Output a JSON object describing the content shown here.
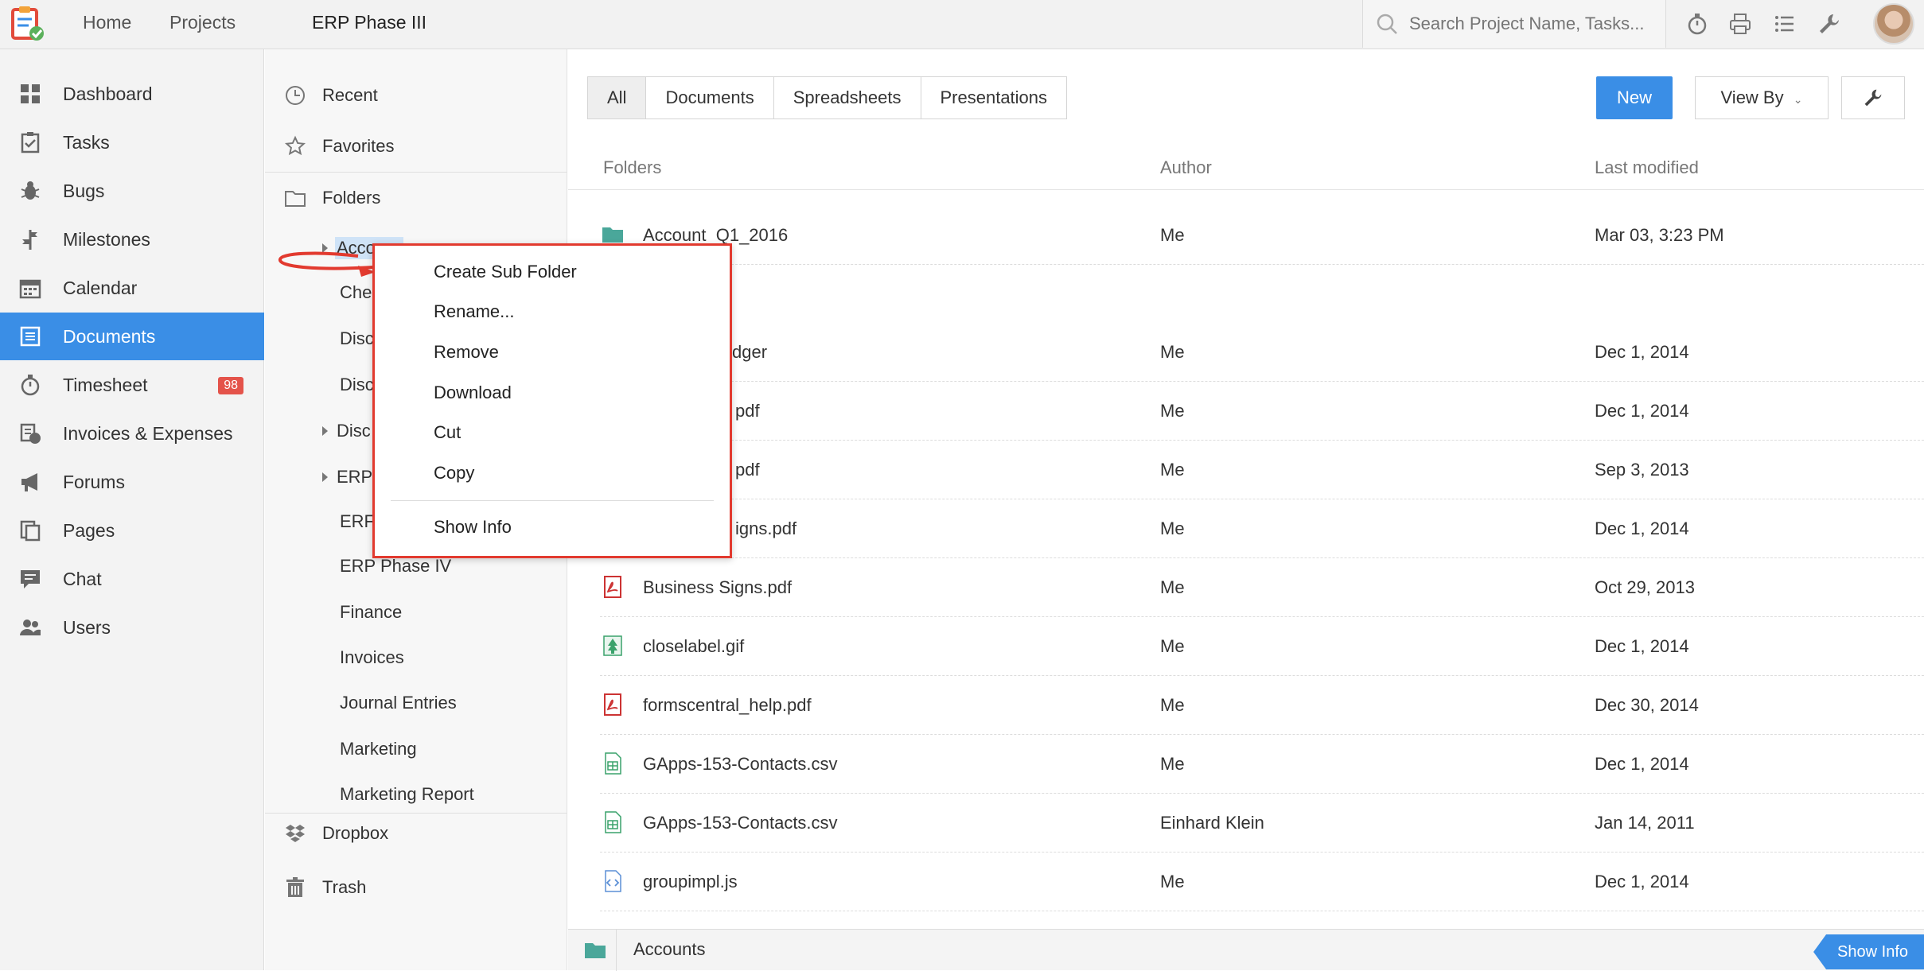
{
  "topbar": {
    "nav": [
      "Home",
      "Projects"
    ],
    "project_title": "ERP Phase III",
    "search_placeholder": "Search Project Name, Tasks..."
  },
  "sidebar": {
    "items": [
      {
        "label": "Dashboard",
        "icon": "dashboard-icon"
      },
      {
        "label": "Tasks",
        "icon": "tasks-icon"
      },
      {
        "label": "Bugs",
        "icon": "bug-icon"
      },
      {
        "label": "Milestones",
        "icon": "milestone-icon"
      },
      {
        "label": "Calendar",
        "icon": "calendar-icon"
      },
      {
        "label": "Documents",
        "icon": "documents-icon",
        "active": true
      },
      {
        "label": "Timesheet",
        "icon": "timer-icon",
        "badge": "98"
      },
      {
        "label": "Invoices & Expenses",
        "icon": "invoice-icon"
      },
      {
        "label": "Forums",
        "icon": "megaphone-icon"
      },
      {
        "label": "Pages",
        "icon": "pages-icon"
      },
      {
        "label": "Chat",
        "icon": "chat-icon"
      },
      {
        "label": "Users",
        "icon": "users-icon"
      }
    ]
  },
  "tree": {
    "recent": "Recent",
    "favorites": "Favorites",
    "folders": "Folders",
    "children": [
      "Acco",
      "Che",
      "Disc",
      "Disc",
      "Disc",
      "ERP",
      "ERF",
      "ERP Phase IV",
      "Finance",
      "Invoices",
      "Journal Entries",
      "Marketing",
      "Marketing Report"
    ],
    "dropbox": "Dropbox",
    "trash": "Trash"
  },
  "main": {
    "tabs": [
      "All",
      "Documents",
      "Spreadsheets",
      "Presentations"
    ],
    "new_label": "New",
    "viewby_label": "View By",
    "columns": {
      "name": "Folders",
      "author": "Author",
      "modified": "Last modified"
    },
    "rows": [
      {
        "name": "Account_Q1_2016",
        "author": "Me",
        "modified": "Mar 03, 3:23 PM",
        "icon": "folder-icon"
      },
      {
        "name": "dger",
        "author": "Me",
        "modified": "Dec 1, 2014",
        "icon": "file-icon"
      },
      {
        "name": "pdf",
        "author": "Me",
        "modified": "Dec 1, 2014",
        "icon": "pdf-icon"
      },
      {
        "name": "pdf",
        "author": "Me",
        "modified": "Sep 3, 2013",
        "icon": "pdf-icon"
      },
      {
        "name": "igns.pdf",
        "author": "Me",
        "modified": "Dec 1, 2014",
        "icon": "pdf-icon"
      },
      {
        "name": "Business Signs.pdf",
        "author": "Me",
        "modified": "Oct 29, 2013",
        "icon": "pdf-icon"
      },
      {
        "name": "closelabel.gif",
        "author": "Me",
        "modified": "Dec 1, 2014",
        "icon": "image-icon"
      },
      {
        "name": "formscentral_help.pdf",
        "author": "Me",
        "modified": "Dec 30, 2014",
        "icon": "pdf-icon"
      },
      {
        "name": "GApps-153-Contacts.csv",
        "author": "Me",
        "modified": "Dec 1, 2014",
        "icon": "spreadsheet-icon"
      },
      {
        "name": "GApps-153-Contacts.csv",
        "author": "Einhard Klein",
        "modified": "Jan 14, 2011",
        "icon": "spreadsheet-icon"
      },
      {
        "name": "groupimpl.js",
        "author": "Me",
        "modified": "Dec 1, 2014",
        "icon": "code-file-icon"
      }
    ]
  },
  "bottombar": {
    "breadcrumb": "Accounts",
    "show_info": "Show Info"
  },
  "context_menu": {
    "items": [
      "Create Sub Folder",
      "Rename...",
      "Remove",
      "Download",
      "Cut",
      "Copy"
    ],
    "footer_item": "Show Info"
  },
  "colors": {
    "accent": "#3a8ee6",
    "badge": "#e4534a",
    "annotation_red": "#e23a2f",
    "folder_green": "#4aa79a"
  }
}
